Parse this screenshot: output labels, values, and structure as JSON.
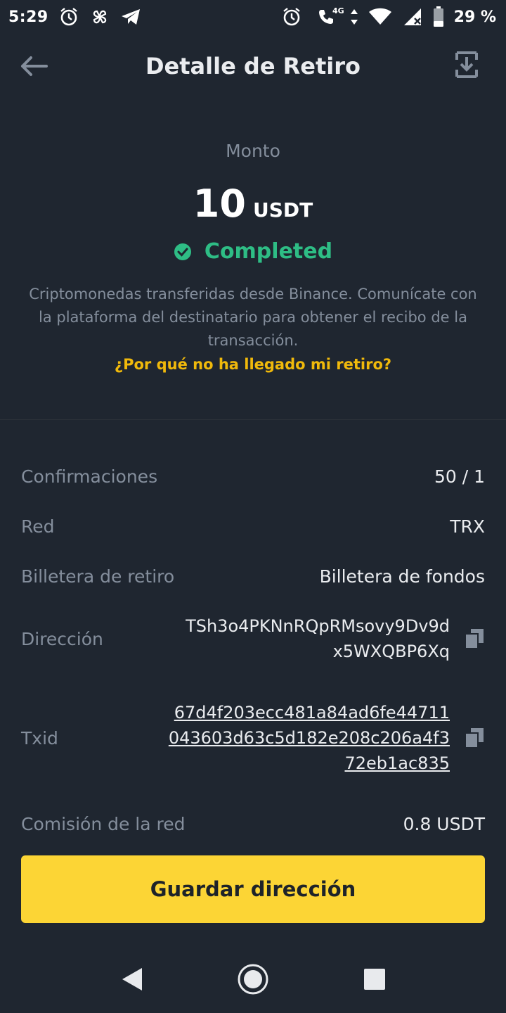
{
  "status_bar": {
    "time": "5:29",
    "battery_text": "29 %",
    "network_label": "4G",
    "icons_left": [
      "alarm-icon",
      "pinwheel-icon",
      "telegram-icon"
    ],
    "icons_right": [
      "alarm-icon",
      "wifi-calling-icon",
      "wifi-icon",
      "signal-icon",
      "battery-icon"
    ]
  },
  "header": {
    "title": "Detalle de Retiro",
    "back_icon": "arrow-left-icon",
    "action_icon": "download-icon"
  },
  "amount": {
    "label": "Monto",
    "value": "10",
    "unit": "USDT",
    "status": "Completed",
    "status_color": "#2ebd85"
  },
  "description": "Criptomonedas transferidas desde Binance. Comunícate con la plataforma del destinatario para obtener el recibo de la transacción.",
  "help_link": "¿Por qué no ha llegado mi retiro?",
  "details": {
    "confirmations": {
      "label": "Confirmaciones",
      "value": "50 / 1"
    },
    "network": {
      "label": "Red",
      "value": "TRX"
    },
    "wallet": {
      "label": "Billetera de retiro",
      "value": "Billetera de fondos"
    },
    "address": {
      "label": "Dirección",
      "line1": "TSh3o4PKNnRQpRMsovy9Dv9d",
      "line2": "x5WXQBP6Xq"
    },
    "txid": {
      "label": "Txid",
      "line1": "67d4f203ecc481a84ad6fe44711",
      "line2": "043603d63c5d182e208c206a4f3",
      "line3": "72eb1ac835"
    },
    "fee": {
      "label": "Comisión de la red",
      "value": "0.8 USDT"
    }
  },
  "primary_button": "Guardar dirección",
  "colors": {
    "background": "#1f2630",
    "accent": "#fcd535",
    "link": "#f0b90b",
    "success": "#2ebd85",
    "muted": "#848e9c"
  },
  "nav": [
    "back-icon",
    "home-icon",
    "recents-icon"
  ]
}
